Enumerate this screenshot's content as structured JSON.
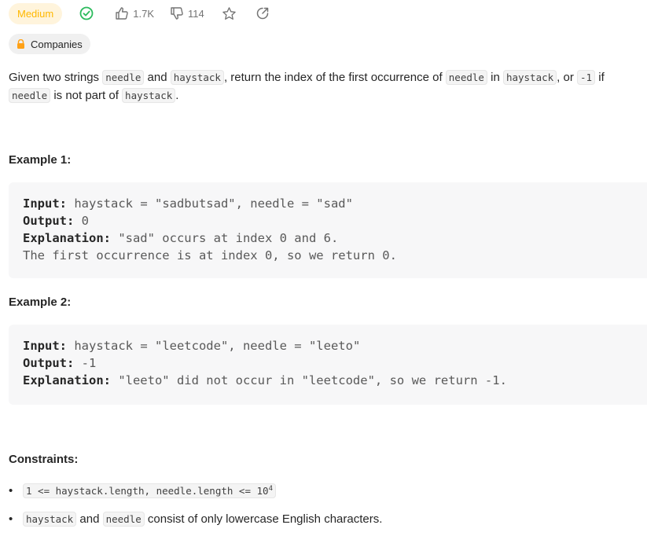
{
  "header": {
    "difficulty": "Medium",
    "likes": "1.7K",
    "dislikes": "114"
  },
  "tag": {
    "label": "Companies"
  },
  "description": {
    "t1": "Given two strings ",
    "c1": "needle",
    "t2": " and ",
    "c2": "haystack",
    "t3": ", return the index of the first occurrence of ",
    "c3": "needle",
    "t4": " in ",
    "c4": "haystack",
    "t5": ", or ",
    "c5": "-1",
    "t6": " if",
    "c6": "needle",
    "t7": " is not part of ",
    "c7": "haystack",
    "t8": "."
  },
  "example1": {
    "heading": "Example 1:",
    "input_label": "Input:",
    "input_value": " haystack = \"sadbutsad\", needle = \"sad\"",
    "output_label": "Output:",
    "output_value": " 0",
    "explanation_label": "Explanation:",
    "explanation_value": " \"sad\" occurs at index 0 and 6.",
    "extra_line": "The first occurrence is at index 0, so we return 0."
  },
  "example2": {
    "heading": "Example 2:",
    "input_label": "Input:",
    "input_value": " haystack = \"leetcode\", needle = \"leeto\"",
    "output_label": "Output:",
    "output_value": " -1",
    "explanation_label": "Explanation:",
    "explanation_value": " \"leeto\" did not occur in \"leetcode\", so we return -1."
  },
  "constraints": {
    "heading": "Constraints:",
    "c1_code": "1 <= haystack.length, needle.length <= 10",
    "c1_exp": "4",
    "c2_code_a": "haystack",
    "c2_t1": " and ",
    "c2_code_b": "needle",
    "c2_t2": " consist of only lowercase English characters."
  }
}
